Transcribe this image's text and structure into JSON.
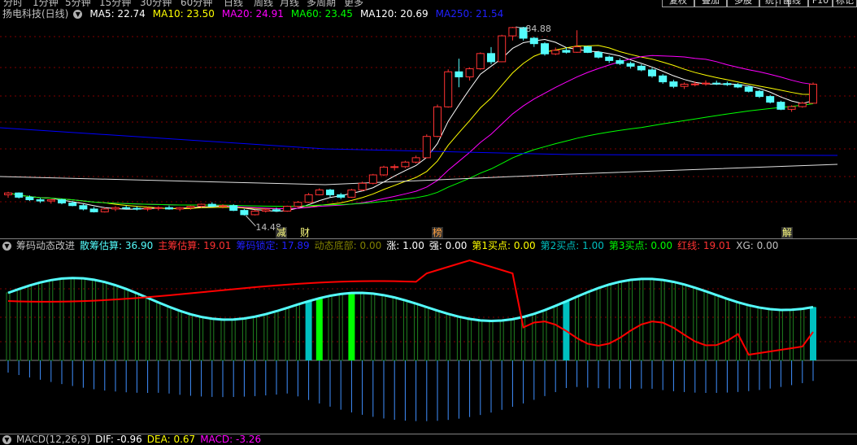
{
  "colors": {
    "up": "#ff3232",
    "down": "#54fcfc",
    "ma5": "#ffffff",
    "ma10": "#ffff00",
    "ma20": "#ff00ff",
    "ma60": "#00ff00",
    "ma120": "#ffffff",
    "ma250": "#0000ff",
    "red_line": "#ff0000",
    "green_bar": "#00ff00",
    "cyan_bar": "#00c0c0",
    "bg": "#000000"
  },
  "top_menu": {
    "tabs": [
      "分时",
      "1分钟",
      "5分钟",
      "15分钟",
      "30分钟",
      "60分钟",
      "日线",
      "周线",
      "月线",
      "多周期",
      "更多"
    ],
    "tools": [
      "复权",
      "叠加",
      "多股",
      "统计",
      "画线",
      "F10",
      "标记"
    ]
  },
  "price_header": {
    "title": "扬电科技(日线)",
    "ma5": "MA5: 22.74",
    "ma10": "MA10: 23.50",
    "ma20": "MA20: 24.91",
    "ma60": "MA60: 23.45",
    "ma120": "MA120: 20.69",
    "ma250": "MA250: 21.54"
  },
  "annotations": {
    "high": "84.88",
    "low": "14.48"
  },
  "events": [
    "减",
    "财",
    "榜",
    "解"
  ],
  "indicator": {
    "name": "筹码动态改进",
    "retail": "散筹估算: 36.90",
    "main": "主筹估算: 19.01",
    "lock": "筹码锁定: 17.89",
    "bottom": "动态底部: 0.00",
    "rise": "涨: 1.00",
    "strong": "强: 0.00",
    "buy1": "第1买点: 0.00",
    "buy2": "第2买点: 1.00",
    "buy3": "第3买点: 0.00",
    "redline": "红线: 19.01",
    "xg": "XG: 0.00"
  },
  "macd_header": {
    "name": "MACD(12,26,9)",
    "dif": "DIF: -0.96",
    "dea": "DEA: 0.67",
    "macd": "MACD: -3.26"
  },
  "chart_data": [
    {
      "type": "candlestick",
      "title": "扬电科技(日线)",
      "ohlc": [
        [
          17.6,
          18.1,
          17.1,
          17.9
        ],
        [
          17.9,
          18.0,
          17.0,
          17.2
        ],
        [
          17.2,
          17.5,
          16.6,
          16.8
        ],
        [
          16.8,
          17.1,
          16.3,
          16.6
        ],
        [
          16.6,
          16.9,
          16.2,
          16.8
        ],
        [
          16.8,
          17.0,
          16.1,
          16.3
        ],
        [
          16.3,
          16.6,
          15.8,
          15.9
        ],
        [
          15.9,
          16.2,
          15.2,
          15.4
        ],
        [
          15.4,
          15.7,
          14.9,
          15.0
        ],
        [
          15.0,
          15.6,
          14.9,
          15.4
        ],
        [
          15.4,
          15.8,
          15.1,
          15.6
        ],
        [
          15.6,
          15.9,
          15.3,
          15.5
        ],
        [
          15.5,
          15.8,
          15.2,
          15.4
        ],
        [
          15.4,
          15.7,
          15.1,
          15.5
        ],
        [
          15.5,
          15.8,
          15.2,
          15.6
        ],
        [
          15.6,
          15.9,
          15.3,
          15.4
        ],
        [
          15.4,
          15.7,
          15.1,
          15.6
        ],
        [
          15.6,
          15.9,
          15.3,
          15.8
        ],
        [
          15.8,
          16.2,
          15.6,
          16.1
        ],
        [
          16.1,
          16.4,
          15.7,
          15.8
        ],
        [
          15.8,
          16.1,
          15.5,
          15.9
        ],
        [
          15.9,
          16.1,
          15.1,
          15.2
        ],
        [
          15.2,
          15.4,
          14.48,
          14.6
        ],
        [
          14.6,
          15.3,
          14.5,
          15.1
        ],
        [
          15.1,
          15.5,
          14.9,
          15.3
        ],
        [
          15.3,
          15.6,
          15.0,
          15.1
        ],
        [
          15.1,
          15.9,
          15.0,
          15.8
        ],
        [
          15.8,
          16.6,
          15.6,
          16.4
        ],
        [
          16.4,
          17.9,
          16.3,
          17.6
        ],
        [
          17.6,
          18.7,
          17.5,
          18.4
        ],
        [
          18.4,
          18.6,
          17.2,
          17.6
        ],
        [
          17.6,
          17.9,
          16.9,
          17.2
        ],
        [
          17.2,
          18.6,
          17.1,
          18.4
        ],
        [
          18.4,
          19.9,
          18.2,
          19.6
        ],
        [
          19.6,
          21.4,
          19.4,
          21.2
        ],
        [
          21.2,
          23.1,
          21.0,
          22.8
        ],
        [
          22.8,
          23.4,
          22.1,
          22.9
        ],
        [
          22.9,
          24.2,
          22.6,
          23.9
        ],
        [
          23.9,
          25.4,
          23.6,
          24.9
        ],
        [
          24.9,
          31.0,
          24.8,
          30.4
        ],
        [
          30.4,
          41.0,
          30.2,
          40.1
        ],
        [
          40.1,
          57.0,
          39.8,
          55.7
        ],
        [
          55.7,
          63.0,
          48.2,
          53.1
        ],
        [
          53.1,
          58.0,
          51.3,
          57.3
        ],
        [
          57.3,
          66.8,
          56.8,
          66.1
        ],
        [
          66.1,
          70.2,
          59.7,
          61.2
        ],
        [
          61.2,
          78.8,
          61.0,
          78.0
        ],
        [
          78.0,
          84.88,
          74.7,
          84.3
        ],
        [
          84.3,
          84.88,
          74.7,
          76.3
        ],
        [
          76.3,
          77.3,
          70.3,
          72.5
        ],
        [
          72.5,
          73.5,
          64.8,
          65.9
        ],
        [
          65.9,
          69.9,
          65.1,
          68.1
        ],
        [
          68.1,
          69.9,
          66.1,
          66.9
        ],
        [
          66.9,
          82.2,
          66.5,
          70.4
        ],
        [
          70.4,
          71.1,
          66.4,
          66.8
        ],
        [
          66.8,
          67.8,
          63.1,
          63.9
        ],
        [
          63.9,
          64.8,
          60.5,
          61.9
        ],
        [
          61.9,
          63.2,
          59.3,
          60.2
        ],
        [
          60.2,
          61.3,
          57.4,
          58.7
        ],
        [
          58.7,
          59.8,
          56.0,
          56.7
        ],
        [
          56.7,
          57.8,
          52.7,
          53.6
        ],
        [
          53.6,
          54.5,
          49.8,
          50.7
        ],
        [
          50.7,
          51.7,
          47.8,
          48.6
        ],
        [
          48.6,
          50.4,
          47.4,
          49.6
        ],
        [
          49.6,
          50.9,
          48.6,
          49.7
        ],
        [
          49.7,
          51.4,
          48.9,
          50.1
        ],
        [
          50.1,
          51.3,
          49.2,
          49.9
        ],
        [
          49.9,
          50.8,
          48.8,
          49.4
        ],
        [
          49.4,
          50.1,
          47.8,
          48.3
        ],
        [
          48.3,
          48.9,
          45.9,
          46.4
        ],
        [
          46.4,
          47.0,
          43.6,
          44.2
        ],
        [
          44.2,
          44.8,
          41.4,
          41.9
        ],
        [
          41.9,
          42.5,
          38.9,
          39.2
        ],
        [
          39.2,
          40.7,
          38.3,
          40.2
        ],
        [
          40.2,
          42.1,
          39.8,
          41.5
        ],
        [
          41.5,
          50.4,
          41.3,
          49.6
        ]
      ]
    }
  ]
}
